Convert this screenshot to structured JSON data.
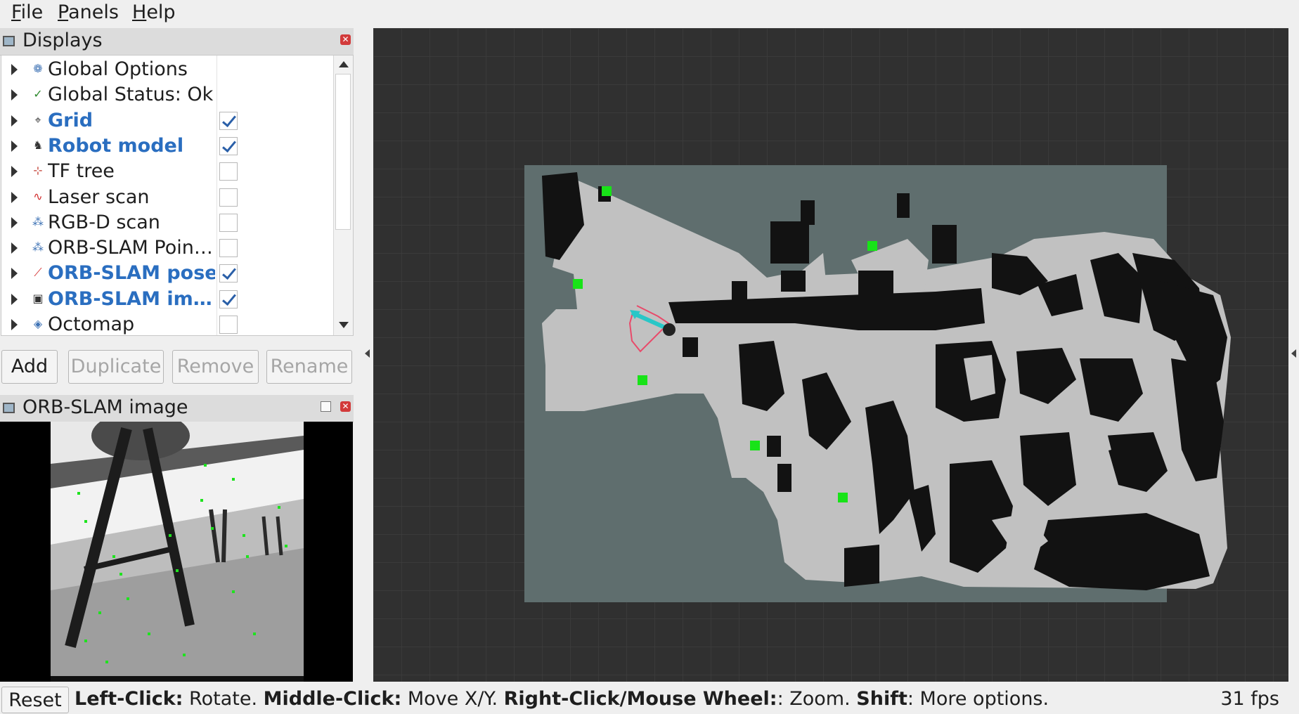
{
  "menu": {
    "items": [
      {
        "label": "File",
        "accel": "F",
        "rest": "ile"
      },
      {
        "label": "Panels",
        "accel": "P",
        "rest": "anels"
      },
      {
        "label": "Help",
        "accel": "H",
        "rest": "elp"
      }
    ]
  },
  "displays": {
    "title": "Displays",
    "items": [
      {
        "label": "Global Options",
        "icon": "gear-icon",
        "glyph": "❁",
        "color": "#3f73b5",
        "enabled": null
      },
      {
        "label": "Global Status: Ok",
        "icon": "check-icon",
        "glyph": "✓",
        "color": "#2f8a2f",
        "enabled": null
      },
      {
        "label": "Grid",
        "icon": "grid-icon",
        "glyph": "⌖",
        "color": "#333333",
        "enabled": true
      },
      {
        "label": "Robot model",
        "icon": "robot-icon",
        "glyph": "♞",
        "color": "#333333",
        "enabled": true
      },
      {
        "label": "TF tree",
        "icon": "axes-icon",
        "glyph": "⊹",
        "color": "#c23b2f",
        "enabled": false
      },
      {
        "label": "Laser scan",
        "icon": "laser-icon",
        "glyph": "∿",
        "color": "#d22a2a",
        "enabled": false
      },
      {
        "label": "RGB-D scan",
        "icon": "pointcloud-icon",
        "glyph": "⁂",
        "color": "#3f73b5",
        "enabled": false
      },
      {
        "label": "ORB-SLAM Poin…",
        "icon": "pointcloud-icon",
        "glyph": "⁂",
        "color": "#3f73b5",
        "enabled": false
      },
      {
        "label": "ORB-SLAM pose",
        "icon": "pose-arrow-icon",
        "glyph": "⟋",
        "color": "#d22a2a",
        "enabled": true
      },
      {
        "label": "ORB-SLAM im…",
        "icon": "image-icon",
        "glyph": "▣",
        "color": "#333333",
        "enabled": true
      },
      {
        "label": "Octomap",
        "icon": "cube-icon",
        "glyph": "◈",
        "color": "#3f73b5",
        "enabled": false
      }
    ],
    "buttons": {
      "add": "Add",
      "duplicate": "Duplicate",
      "remove": "Remove",
      "rename": "Rename"
    }
  },
  "image_panel": {
    "title": "ORB-SLAM image"
  },
  "status": {
    "reset": "Reset",
    "hint_parts": [
      {
        "b": "Left-Click:",
        "t": " Rotate. "
      },
      {
        "b": "Middle-Click:",
        "t": " Move X/Y. "
      },
      {
        "b": "Right-Click/Mouse Wheel:",
        "t": ": Zoom. "
      },
      {
        "b": "Shift",
        "t": ": More options."
      }
    ],
    "fps": "31 fps"
  },
  "colors": {
    "grid_bg": "#303030",
    "grid_line": "#3d3d3d",
    "map_unknown": "#5f6e6e",
    "map_free": "#c1c1c1",
    "map_occupied": "#121212",
    "keyframe": "#18e318",
    "robot_path": "#e84a6a",
    "pose_arrow": "#29c7c7",
    "checked_label": "#2a6ec0"
  }
}
